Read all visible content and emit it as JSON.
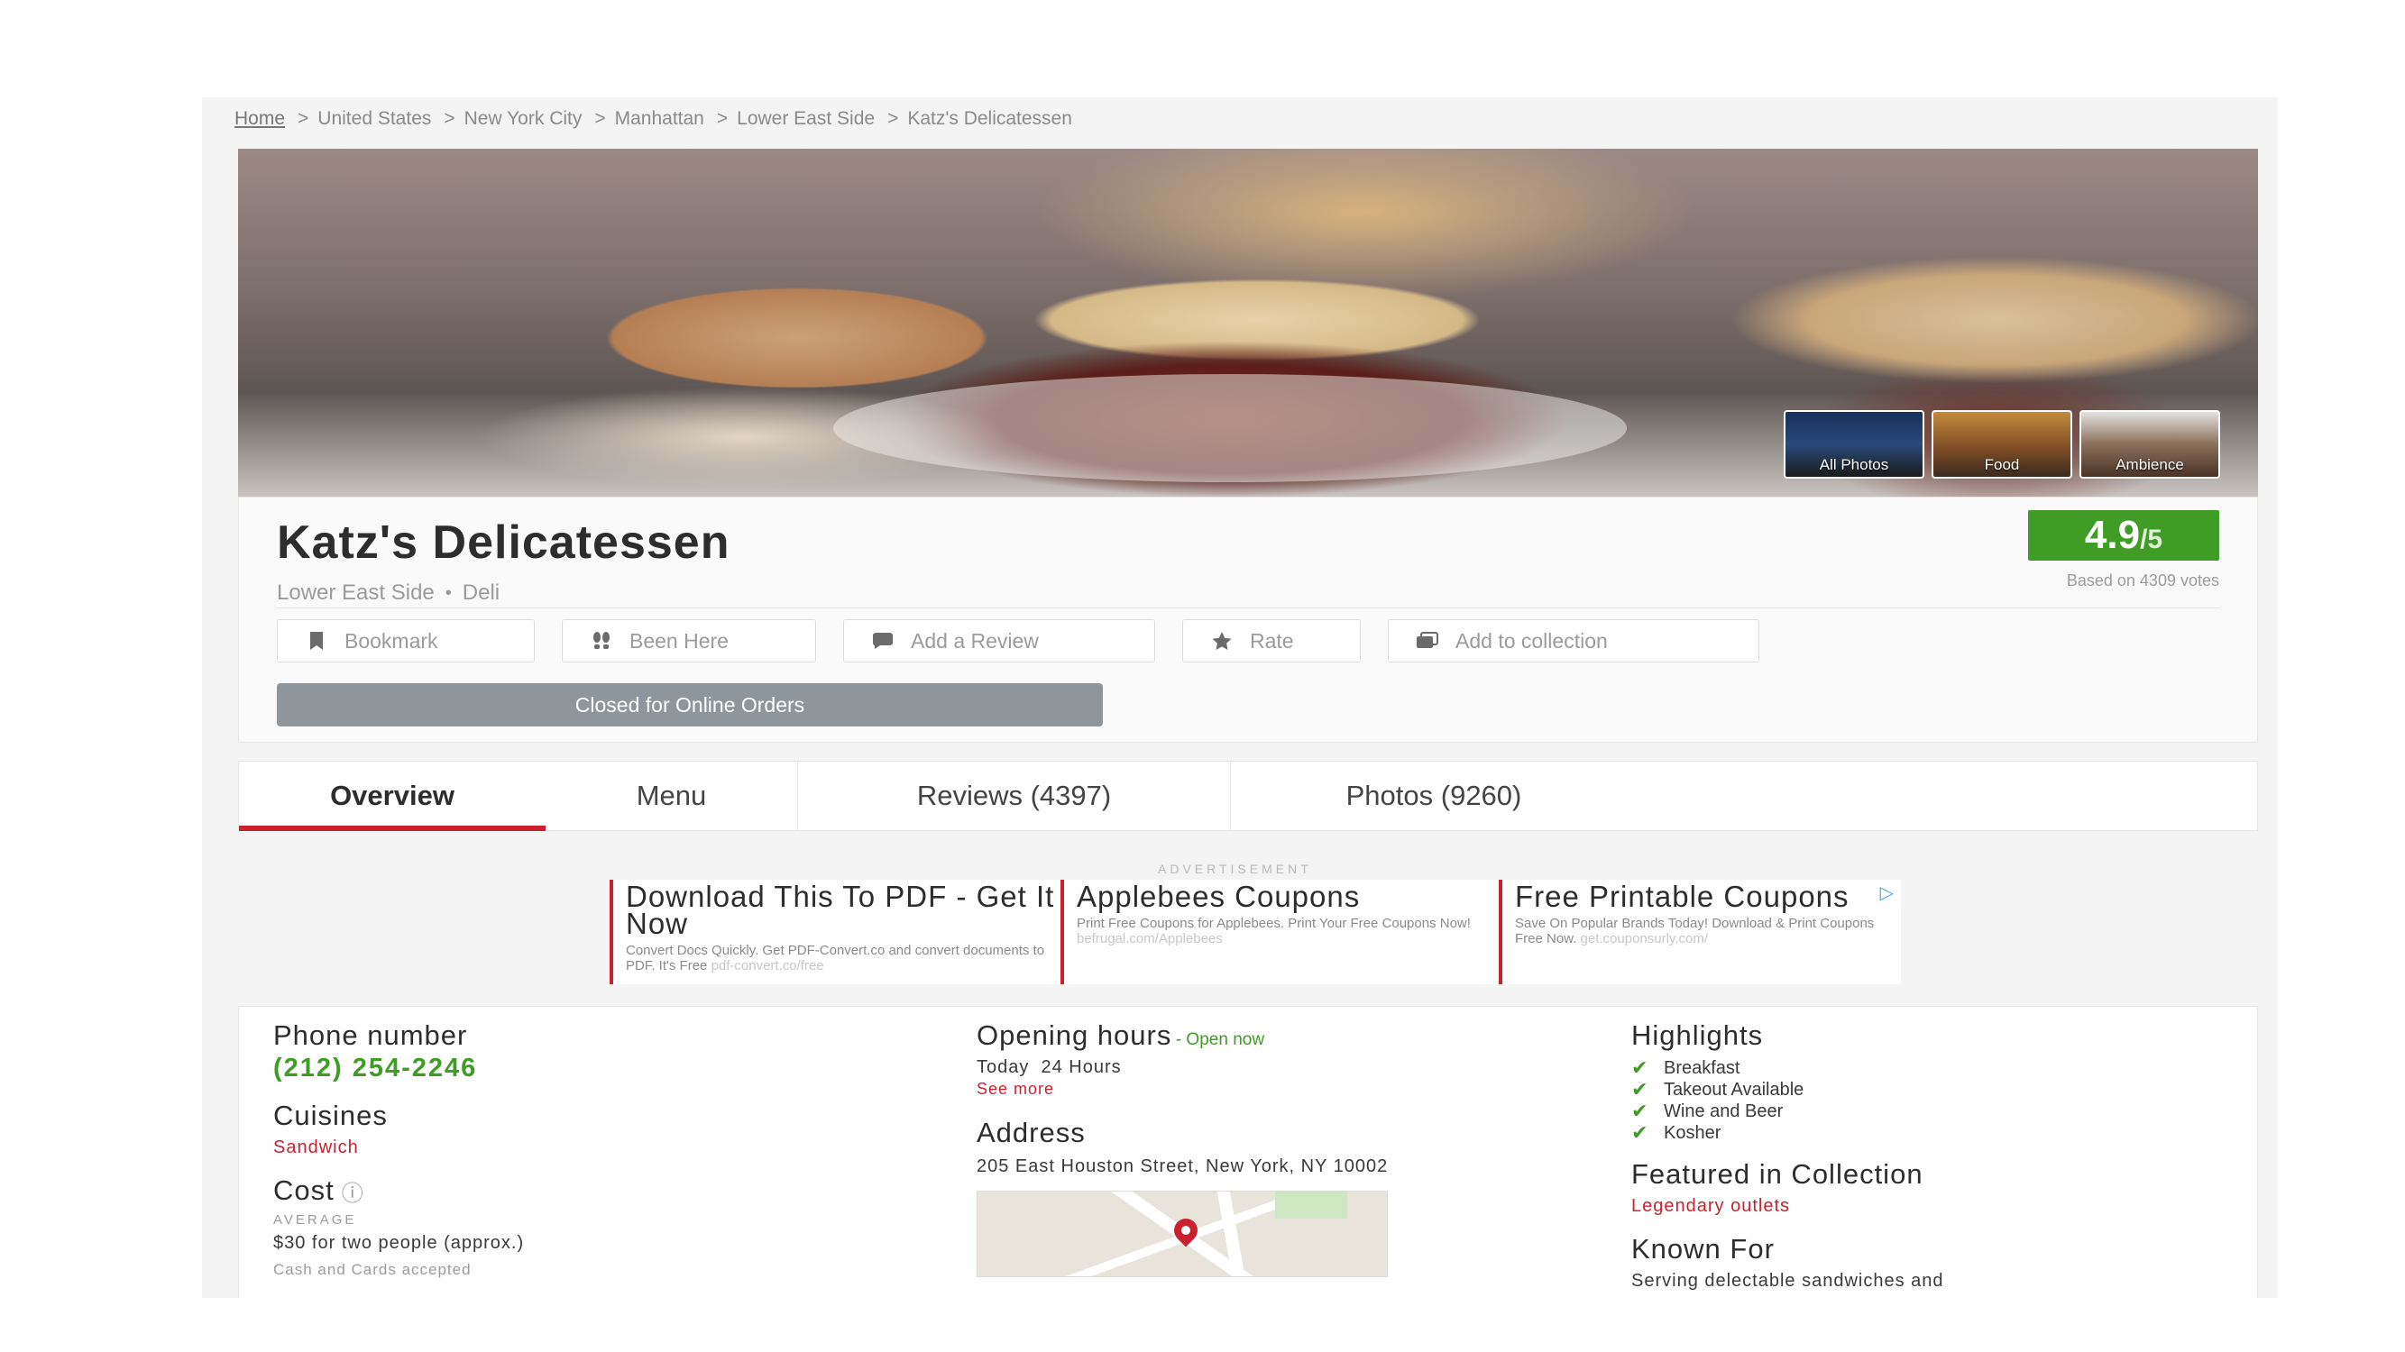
{
  "breadcrumb": {
    "items": [
      "Home",
      "United States",
      "New York City",
      "Manhattan",
      "Lower East Side",
      "Katz's Delicatessen"
    ],
    "separator": ">"
  },
  "hero": {
    "thumbs": [
      {
        "label": "All Photos"
      },
      {
        "label": "Food"
      },
      {
        "label": "Ambience"
      }
    ]
  },
  "restaurant": {
    "name": "Katz's Delicatessen",
    "locality": "Lower East Side",
    "dot": "•",
    "category": "Deli",
    "rating": "4.9",
    "rating_outof": "/5",
    "votes": "Based on 4309 votes"
  },
  "actions": {
    "bookmark": "Bookmark",
    "been_here": "Been Here",
    "add_review": "Add a Review",
    "rate": "Rate",
    "add_collection": "Add to collection",
    "order": "Closed for Online Orders"
  },
  "tabs": [
    "Overview",
    "Menu",
    "Reviews (4397)",
    "Photos (9260)"
  ],
  "ad": {
    "label": "ADVERTISEMENT",
    "items": [
      {
        "title": "Download This To PDF - Get It Now",
        "text": "Convert Docs Quickly. Get PDF-Convert.co and convert documents to PDF. It's Free",
        "url": "pdf-convert.co/free"
      },
      {
        "title": "Applebees Coupons",
        "text": "Print Free Coupons for Applebees. Print Your Free Coupons Now!",
        "url": "befrugal.com/Applebees"
      },
      {
        "title": "Free Printable Coupons",
        "text": "Save On Popular Brands Today! Download & Print Coupons Free Now.",
        "url": "get.couponsurly.com/"
      }
    ]
  },
  "details": {
    "phone_label": "Phone number",
    "phone": "(212) 254-2246",
    "cuisines_label": "Cuisines",
    "cuisines": "Sandwich",
    "cost_label": "Cost",
    "cost_info_icon": "ⓘ",
    "cost_sub": "AVERAGE",
    "cost_value": "$30 for two people (approx.)",
    "payment": "Cash and Cards accepted",
    "hours_label": "Opening hours",
    "hours_status": "- Open now",
    "hours_today": "Today  24 Hours",
    "see_more": "See more",
    "address_label": "Address",
    "address": "205 East Houston Street, New York, NY 10002",
    "highlights_label": "Highlights",
    "highlights": [
      "Breakfast",
      "Takeout Available",
      "Wine and Beer",
      "Kosher"
    ],
    "collection_label": "Featured in Collection",
    "collection": "Legendary outlets",
    "known_label": "Known For",
    "known": "Serving delectable sandwiches and"
  },
  "colors": {
    "brand_red": "#cb202d",
    "rating_green": "#3f9c24",
    "disabled_gray": "#8e969b"
  },
  "icons": {
    "bookmark": "bookmark-icon",
    "been_here": "footsteps-icon",
    "review": "review-icon",
    "rate": "star-icon",
    "collection": "collection-icon",
    "check": "check-icon",
    "map_pin": "map-pin-icon",
    "ad_choices": "ad-choices-icon"
  }
}
